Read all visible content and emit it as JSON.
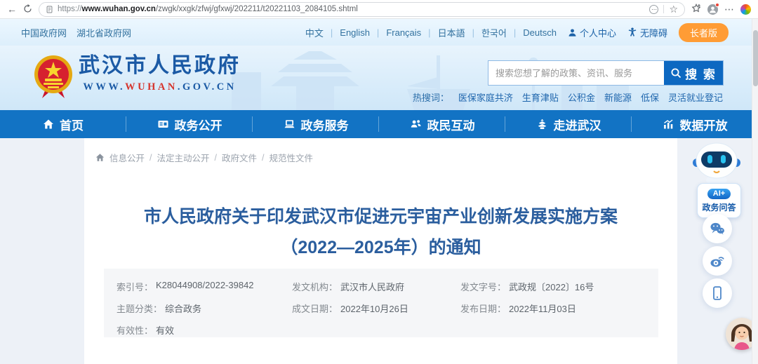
{
  "browser": {
    "url_scheme": "https://",
    "url_domain": "www.wuhan.gov.cn",
    "url_path": "/zwgk/xxgk/zfwj/gfxwj/202211/t20221103_2084105.shtml"
  },
  "utilbar": {
    "gov_link": "中国政府网",
    "hubei_link": "湖北省政府网",
    "languages": [
      "中文",
      "English",
      "Français",
      "日本語",
      "한국어",
      "Deutsch"
    ],
    "lang_separator": "|",
    "personal_center": "个人中心",
    "accessibility": "无障碍",
    "senior_version": "长者版"
  },
  "masthead": {
    "site_name": "武汉市人民政府",
    "url_www": "WWW.",
    "url_highlight": "WUHAN",
    "url_suffix": ".GOV.CN",
    "search_placeholder": "搜索您想了解的政策、资讯、服务",
    "search_button": "搜 索",
    "hot_label": "热搜词：",
    "hot_words": [
      "医保家庭共济",
      "生育津贴",
      "公积金",
      "新能源",
      "低保",
      "灵活就业登记"
    ]
  },
  "nav": {
    "items": [
      {
        "label": "首页"
      },
      {
        "label": "政务公开"
      },
      {
        "label": "政务服务"
      },
      {
        "label": "政民互动"
      },
      {
        "label": "走进武汉"
      },
      {
        "label": "数据开放"
      }
    ]
  },
  "breadcrumb": {
    "separator": "/",
    "items": [
      "信息公开",
      "法定主动公开",
      "政府文件",
      "规范性文件"
    ]
  },
  "article": {
    "title_line1": "市人民政府关于印发武汉市促进元宇宙产业创新发展实施方案",
    "title_line2": "（2022—2025年）的通知",
    "meta": {
      "index_label": "索引号：",
      "index_value": "K28044908/2022-39842",
      "category_label": "主题分类：",
      "category_value": "综合政务",
      "validity_label": "有效性：",
      "validity_value": "有效",
      "agency_label": "发文机构：",
      "agency_value": "武汉市人民政府",
      "written_label": "成文日期：",
      "written_value": "2022年10月26日",
      "docno_label": "发文字号：",
      "docno_value": "武政规〔2022〕16号",
      "published_label": "发布日期：",
      "published_value": "2022年11月03日"
    }
  },
  "floating": {
    "ai_pill": "AI+",
    "ai_text": "政务问答"
  },
  "colors": {
    "nav_blue": "#1273c4",
    "accent_blue": "#0d68c1",
    "title_blue": "#2b5e9e",
    "senior_orange": "#ff9c35",
    "link_blue": "#1f66ad"
  }
}
